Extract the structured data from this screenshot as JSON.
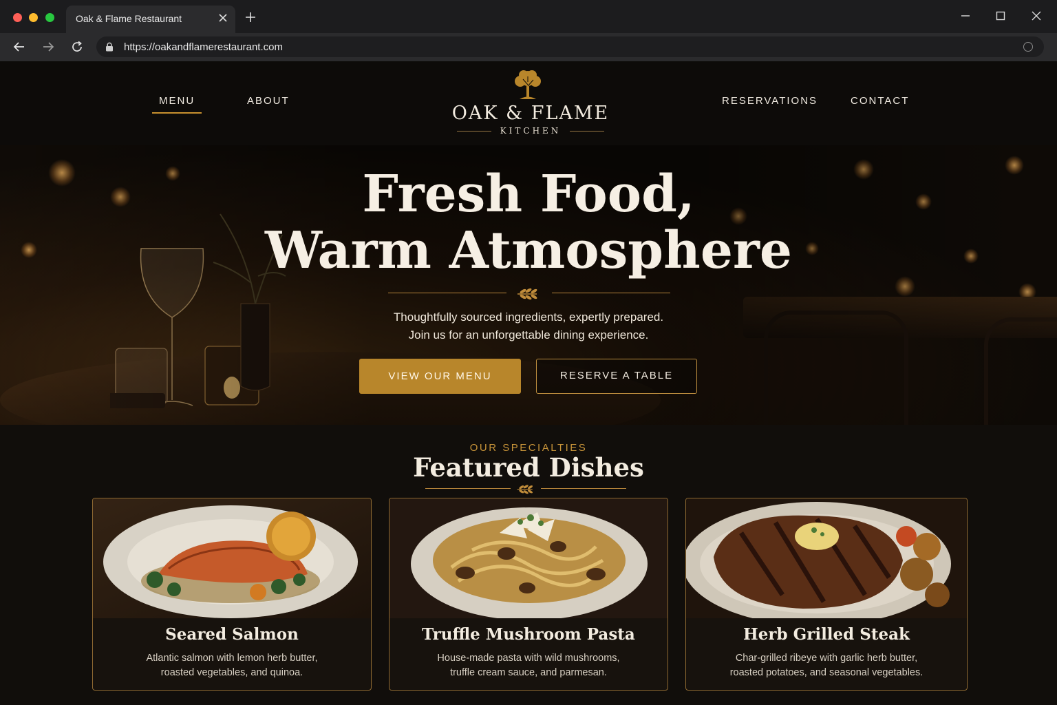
{
  "browser": {
    "tab_title": "Oak & Flame Restaurant",
    "url": "https://oakandflamerestaurant.com"
  },
  "nav": {
    "left": [
      {
        "label": "MENU",
        "active": true
      },
      {
        "label": "ABOUT",
        "active": false
      }
    ],
    "right": [
      {
        "label": "RESERVATIONS"
      },
      {
        "label": "CONTACT"
      }
    ]
  },
  "brand": {
    "name": "OAK & FLAME",
    "sub": "KITCHEN"
  },
  "hero": {
    "title_line1": "Fresh Food,",
    "title_line2": "Warm Atmosphere",
    "desc_line1": "Thoughtfully sourced ingredients, expertly prepared.",
    "desc_line2": "Join us for an unforgettable dining experience.",
    "primary_button": "VIEW OUR MENU",
    "secondary_button": "RESERVE A TABLE"
  },
  "featured": {
    "kicker": "OUR SPECIALTIES",
    "title": "Featured Dishes",
    "dishes": [
      {
        "name": "Seared Salmon",
        "desc_line1": "Atlantic salmon with lemon herb butter,",
        "desc_line2": "roasted vegetables, and quinoa."
      },
      {
        "name": "Truffle Mushroom Pasta",
        "desc_line1": "House-made pasta with wild mushrooms,",
        "desc_line2": "truffle cream sauce, and parmesan."
      },
      {
        "name": "Herb Grilled Steak",
        "desc_line1": "Char-grilled ribeye with garlic herb butter,",
        "desc_line2": "roasted potatoes, and seasonal vegetables."
      }
    ]
  },
  "colors": {
    "accent": "#b8862b",
    "background": "#110e0b",
    "text": "#f3ece0"
  }
}
